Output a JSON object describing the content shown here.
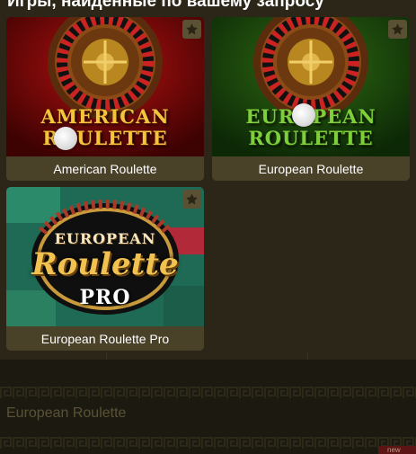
{
  "heading": "Игры, найденные по вашему запросу",
  "games": [
    {
      "caption": "American Roulette",
      "art_lines": [
        "AMERICAN",
        "ROULETTE"
      ]
    },
    {
      "caption": "European Roulette",
      "art_lines": [
        "EUROPEAN",
        "ROULETTE"
      ]
    },
    {
      "caption": "European Roulette Pro",
      "art_lines": [
        "EUROPEAN",
        "Roulette",
        "PRO"
      ]
    }
  ],
  "band_title": "European Roulette",
  "badge": "new",
  "icons": {
    "favorite": "star-icon",
    "cursor": "cursor-icon"
  },
  "colors": {
    "background": "#2b2617",
    "caption_bg": "#4a4129",
    "accent": "#d8aa4a"
  }
}
